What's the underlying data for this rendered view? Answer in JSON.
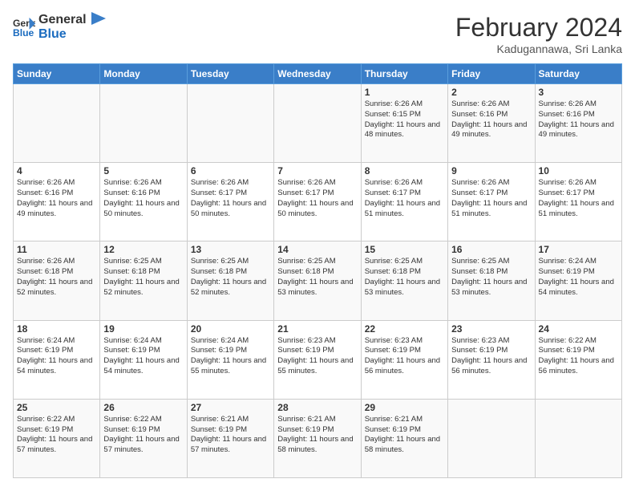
{
  "header": {
    "logo_general": "General",
    "logo_blue": "Blue",
    "month_title": "February 2024",
    "location": "Kadugannawa, Sri Lanka"
  },
  "days_of_week": [
    "Sunday",
    "Monday",
    "Tuesday",
    "Wednesday",
    "Thursday",
    "Friday",
    "Saturday"
  ],
  "weeks": [
    [
      {
        "day": "",
        "info": ""
      },
      {
        "day": "",
        "info": ""
      },
      {
        "day": "",
        "info": ""
      },
      {
        "day": "",
        "info": ""
      },
      {
        "day": "1",
        "info": "Sunrise: 6:26 AM\nSunset: 6:15 PM\nDaylight: 11 hours and 48 minutes."
      },
      {
        "day": "2",
        "info": "Sunrise: 6:26 AM\nSunset: 6:16 PM\nDaylight: 11 hours and 49 minutes."
      },
      {
        "day": "3",
        "info": "Sunrise: 6:26 AM\nSunset: 6:16 PM\nDaylight: 11 hours and 49 minutes."
      }
    ],
    [
      {
        "day": "4",
        "info": "Sunrise: 6:26 AM\nSunset: 6:16 PM\nDaylight: 11 hours and 49 minutes."
      },
      {
        "day": "5",
        "info": "Sunrise: 6:26 AM\nSunset: 6:16 PM\nDaylight: 11 hours and 50 minutes."
      },
      {
        "day": "6",
        "info": "Sunrise: 6:26 AM\nSunset: 6:17 PM\nDaylight: 11 hours and 50 minutes."
      },
      {
        "day": "7",
        "info": "Sunrise: 6:26 AM\nSunset: 6:17 PM\nDaylight: 11 hours and 50 minutes."
      },
      {
        "day": "8",
        "info": "Sunrise: 6:26 AM\nSunset: 6:17 PM\nDaylight: 11 hours and 51 minutes."
      },
      {
        "day": "9",
        "info": "Sunrise: 6:26 AM\nSunset: 6:17 PM\nDaylight: 11 hours and 51 minutes."
      },
      {
        "day": "10",
        "info": "Sunrise: 6:26 AM\nSunset: 6:17 PM\nDaylight: 11 hours and 51 minutes."
      }
    ],
    [
      {
        "day": "11",
        "info": "Sunrise: 6:26 AM\nSunset: 6:18 PM\nDaylight: 11 hours and 52 minutes."
      },
      {
        "day": "12",
        "info": "Sunrise: 6:25 AM\nSunset: 6:18 PM\nDaylight: 11 hours and 52 minutes."
      },
      {
        "day": "13",
        "info": "Sunrise: 6:25 AM\nSunset: 6:18 PM\nDaylight: 11 hours and 52 minutes."
      },
      {
        "day": "14",
        "info": "Sunrise: 6:25 AM\nSunset: 6:18 PM\nDaylight: 11 hours and 53 minutes."
      },
      {
        "day": "15",
        "info": "Sunrise: 6:25 AM\nSunset: 6:18 PM\nDaylight: 11 hours and 53 minutes."
      },
      {
        "day": "16",
        "info": "Sunrise: 6:25 AM\nSunset: 6:18 PM\nDaylight: 11 hours and 53 minutes."
      },
      {
        "day": "17",
        "info": "Sunrise: 6:24 AM\nSunset: 6:19 PM\nDaylight: 11 hours and 54 minutes."
      }
    ],
    [
      {
        "day": "18",
        "info": "Sunrise: 6:24 AM\nSunset: 6:19 PM\nDaylight: 11 hours and 54 minutes."
      },
      {
        "day": "19",
        "info": "Sunrise: 6:24 AM\nSunset: 6:19 PM\nDaylight: 11 hours and 54 minutes."
      },
      {
        "day": "20",
        "info": "Sunrise: 6:24 AM\nSunset: 6:19 PM\nDaylight: 11 hours and 55 minutes."
      },
      {
        "day": "21",
        "info": "Sunrise: 6:23 AM\nSunset: 6:19 PM\nDaylight: 11 hours and 55 minutes."
      },
      {
        "day": "22",
        "info": "Sunrise: 6:23 AM\nSunset: 6:19 PM\nDaylight: 11 hours and 56 minutes."
      },
      {
        "day": "23",
        "info": "Sunrise: 6:23 AM\nSunset: 6:19 PM\nDaylight: 11 hours and 56 minutes."
      },
      {
        "day": "24",
        "info": "Sunrise: 6:22 AM\nSunset: 6:19 PM\nDaylight: 11 hours and 56 minutes."
      }
    ],
    [
      {
        "day": "25",
        "info": "Sunrise: 6:22 AM\nSunset: 6:19 PM\nDaylight: 11 hours and 57 minutes."
      },
      {
        "day": "26",
        "info": "Sunrise: 6:22 AM\nSunset: 6:19 PM\nDaylight: 11 hours and 57 minutes."
      },
      {
        "day": "27",
        "info": "Sunrise: 6:21 AM\nSunset: 6:19 PM\nDaylight: 11 hours and 57 minutes."
      },
      {
        "day": "28",
        "info": "Sunrise: 6:21 AM\nSunset: 6:19 PM\nDaylight: 11 hours and 58 minutes."
      },
      {
        "day": "29",
        "info": "Sunrise: 6:21 AM\nSunset: 6:19 PM\nDaylight: 11 hours and 58 minutes."
      },
      {
        "day": "",
        "info": ""
      },
      {
        "day": "",
        "info": ""
      }
    ]
  ]
}
